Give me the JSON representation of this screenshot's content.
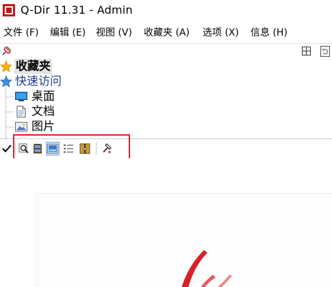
{
  "window": {
    "title": "Q-Dir 11.31 - Admin"
  },
  "menu": [
    {
      "label": "文件 (F)"
    },
    {
      "label": "编辑 (E)"
    },
    {
      "label": "视图 (V)"
    },
    {
      "label": "收藏夹 (A)"
    },
    {
      "label": "选项 (X)"
    },
    {
      "label": "信息 (H)"
    }
  ],
  "tree": {
    "favorites_label": "收藏夹",
    "quick_access_label": "快速访问",
    "items": [
      {
        "label": "桌面",
        "icon": "desktop-icon"
      },
      {
        "label": "文档",
        "icon": "document-icon"
      },
      {
        "label": "图片",
        "icon": "picture-icon"
      }
    ]
  },
  "toolbar": {
    "buttons": [
      {
        "name": "checkmark-button",
        "icon": "checkmark-icon"
      },
      {
        "name": "preview-button",
        "icon": "magnifier-icon"
      },
      {
        "name": "filmstrip-button",
        "icon": "filmstrip-icon"
      },
      {
        "name": "image-view-button",
        "icon": "image-icon"
      },
      {
        "name": "list-view-button",
        "icon": "list-icon"
      },
      {
        "name": "folder-zip-button",
        "icon": "folder-icon"
      },
      {
        "name": "tools-button",
        "icon": "hammer-icon"
      }
    ]
  },
  "colors": {
    "highlight": "#d81e28",
    "quick_access_text": "#1e3f8c",
    "star": "#f5b400"
  }
}
